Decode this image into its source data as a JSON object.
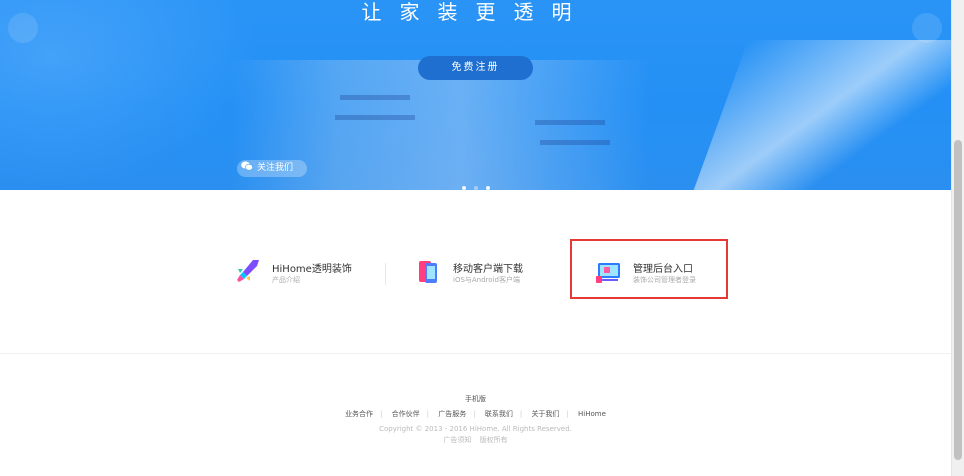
{
  "hero": {
    "title": "让家装更透明",
    "register_button": "免费注册",
    "follow_label": "关注我们",
    "slides": {
      "count": 3,
      "active_index": 2
    }
  },
  "features": [
    {
      "title": "HiHome透明装饰",
      "subtitle": "产品介绍",
      "icon": "rocket-icon"
    },
    {
      "title": "移动客户端下载",
      "subtitle": "iOS与Android客户端",
      "icon": "phone-icon"
    },
    {
      "title": "管理后台入口",
      "subtitle": "装饰公司管理者登录",
      "icon": "monitor-icon"
    }
  ],
  "footer": {
    "mobile_link": "手机版",
    "links": [
      "业务合作",
      "合作伙伴",
      "广告服务",
      "联系我们",
      "关于我们",
      "HiHome"
    ],
    "copyright": "Copyright © 2013 - 2016 HiHome. All Rights Reserved.",
    "bottom_links": [
      "广告须知",
      "版权所有"
    ]
  },
  "colors": {
    "hero_blue": "#2490f5",
    "highlight_red": "#e53935"
  }
}
